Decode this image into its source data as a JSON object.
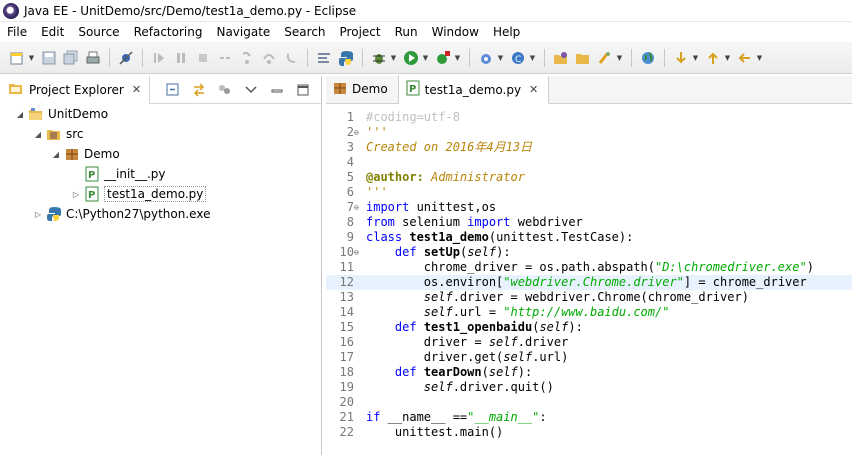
{
  "window": {
    "title": "Java EE - UnitDemo/src/Demo/test1a_demo.py - Eclipse"
  },
  "menu": [
    "File",
    "Edit",
    "Source",
    "Refactoring",
    "Navigate",
    "Search",
    "Project",
    "Run",
    "Window",
    "Help"
  ],
  "project_explorer": {
    "title": "Project Explorer",
    "close": "✕",
    "tree": [
      {
        "label": "UnitDemo"
      },
      {
        "label": "src"
      },
      {
        "label": "Demo"
      },
      {
        "label": "__init__.py"
      },
      {
        "label": "test1a_demo.py"
      },
      {
        "label": "C:\\Python27\\python.exe"
      }
    ]
  },
  "editor": {
    "tabs": [
      {
        "label": "Demo"
      },
      {
        "label": "test1a_demo.py",
        "close": "✕"
      }
    ],
    "lines": [
      {
        "n": "1",
        "parts": [
          [
            "#coding=utf-8",
            "com"
          ]
        ]
      },
      {
        "n": "2",
        "parts": [
          [
            "'''",
            "doc"
          ]
        ]
      },
      {
        "n": "3",
        "parts": [
          [
            "Created on 2016年4月13日",
            "doc"
          ]
        ]
      },
      {
        "n": "4",
        "parts": [
          [
            "",
            ""
          ]
        ]
      },
      {
        "n": "5",
        "parts": [
          [
            "@author:",
            "deco"
          ],
          [
            " Administrator",
            "doc"
          ]
        ]
      },
      {
        "n": "6",
        "parts": [
          [
            "'''",
            "doc"
          ]
        ]
      },
      {
        "n": "7",
        "parts": [
          [
            "import",
            "kw"
          ],
          [
            " unittest,os",
            ""
          ]
        ]
      },
      {
        "n": "8",
        "parts": [
          [
            "from",
            "kw"
          ],
          [
            " selenium ",
            ""
          ],
          [
            "import",
            "kw"
          ],
          [
            " webdriver",
            ""
          ]
        ]
      },
      {
        "n": "9",
        "parts": [
          [
            "class",
            "kw"
          ],
          [
            " ",
            ""
          ],
          [
            "test1a_demo",
            "def-name"
          ],
          [
            "(unittest.TestCase):",
            ""
          ]
        ]
      },
      {
        "n": "10",
        "parts": [
          [
            "    ",
            ""
          ],
          [
            "def",
            "kw"
          ],
          [
            " ",
            ""
          ],
          [
            "setUp",
            "def-name"
          ],
          [
            "(",
            ""
          ],
          [
            "self",
            "self"
          ],
          [
            "):",
            ""
          ]
        ]
      },
      {
        "n": "11",
        "parts": [
          [
            "        chrome_driver = os.path.abspath(",
            ""
          ],
          [
            "\"D:\\chromedriver.exe\"",
            "str"
          ],
          [
            ")",
            ""
          ]
        ]
      },
      {
        "n": "12",
        "parts": [
          [
            "        os.environ[",
            ""
          ],
          [
            "\"webdriver.Chrome.driver\"",
            "str"
          ],
          [
            "] = chrome_driver",
            ""
          ]
        ]
      },
      {
        "n": "13",
        "parts": [
          [
            "        ",
            ""
          ],
          [
            "self",
            "self"
          ],
          [
            ".driver = webdriver.Chrome(chrome_driver)",
            ""
          ]
        ]
      },
      {
        "n": "14",
        "parts": [
          [
            "        ",
            ""
          ],
          [
            "self",
            "self"
          ],
          [
            ".url = ",
            ""
          ],
          [
            "\"http://www.baidu.com/\"",
            "str"
          ]
        ]
      },
      {
        "n": "15",
        "parts": [
          [
            "    ",
            ""
          ],
          [
            "def",
            "kw"
          ],
          [
            " ",
            ""
          ],
          [
            "test1_openbaidu",
            "def-name"
          ],
          [
            "(",
            ""
          ],
          [
            "self",
            "self"
          ],
          [
            "):",
            ""
          ]
        ]
      },
      {
        "n": "16",
        "parts": [
          [
            "        driver = ",
            ""
          ],
          [
            "self",
            "self"
          ],
          [
            ".driver",
            ""
          ]
        ]
      },
      {
        "n": "17",
        "parts": [
          [
            "        driver.get(",
            ""
          ],
          [
            "self",
            "self"
          ],
          [
            ".url)",
            ""
          ]
        ]
      },
      {
        "n": "18",
        "parts": [
          [
            "    ",
            ""
          ],
          [
            "def",
            "kw"
          ],
          [
            " ",
            ""
          ],
          [
            "tearDown",
            "def-name"
          ],
          [
            "(",
            ""
          ],
          [
            "self",
            "self"
          ],
          [
            "):",
            ""
          ]
        ]
      },
      {
        "n": "19",
        "parts": [
          [
            "        ",
            ""
          ],
          [
            "self",
            "self"
          ],
          [
            ".driver.quit()",
            ""
          ]
        ]
      },
      {
        "n": "20",
        "parts": [
          [
            "",
            ""
          ]
        ]
      },
      {
        "n": "21",
        "parts": [
          [
            "if",
            "kw"
          ],
          [
            " __name__ ==",
            ""
          ],
          [
            "\"__main__\"",
            "str"
          ],
          [
            ":",
            ""
          ]
        ]
      },
      {
        "n": "22",
        "parts": [
          [
            "    unittest.main()",
            ""
          ]
        ]
      }
    ]
  },
  "colors": {
    "keyword": "#0000ff",
    "string": "#00aa00",
    "comment": "#c0c0c0",
    "docstring": "#b8860b",
    "current_line": "#e8f2fe"
  }
}
